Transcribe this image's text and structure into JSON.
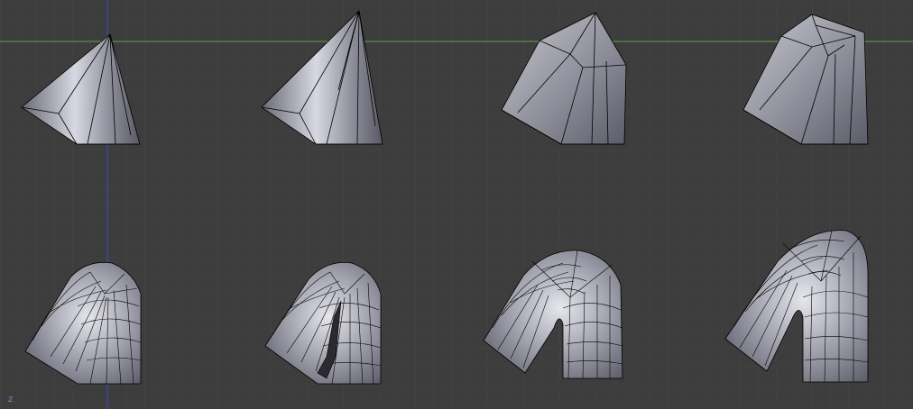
{
  "viewport": {
    "axis_label": "z",
    "colors": {
      "background": "#3d3d3d",
      "grid_minor": "#4a4a4a",
      "grid_major": "#444444",
      "x_axis": "#5fa53a",
      "z_axis": "#3a48c8",
      "mesh_light": "#e0e0e8",
      "mesh_mid": "#9a9aa6",
      "mesh_dark": "#55555f",
      "wire": "#000000"
    },
    "meshes": [
      {
        "id": "mesh-1",
        "stage": 1
      },
      {
        "id": "mesh-2",
        "stage": 2
      },
      {
        "id": "mesh-3",
        "stage": 3
      },
      {
        "id": "mesh-4",
        "stage": 4
      },
      {
        "id": "mesh-5",
        "stage": 5
      },
      {
        "id": "mesh-6",
        "stage": 6
      },
      {
        "id": "mesh-7",
        "stage": 7
      },
      {
        "id": "mesh-8",
        "stage": 8
      }
    ]
  }
}
